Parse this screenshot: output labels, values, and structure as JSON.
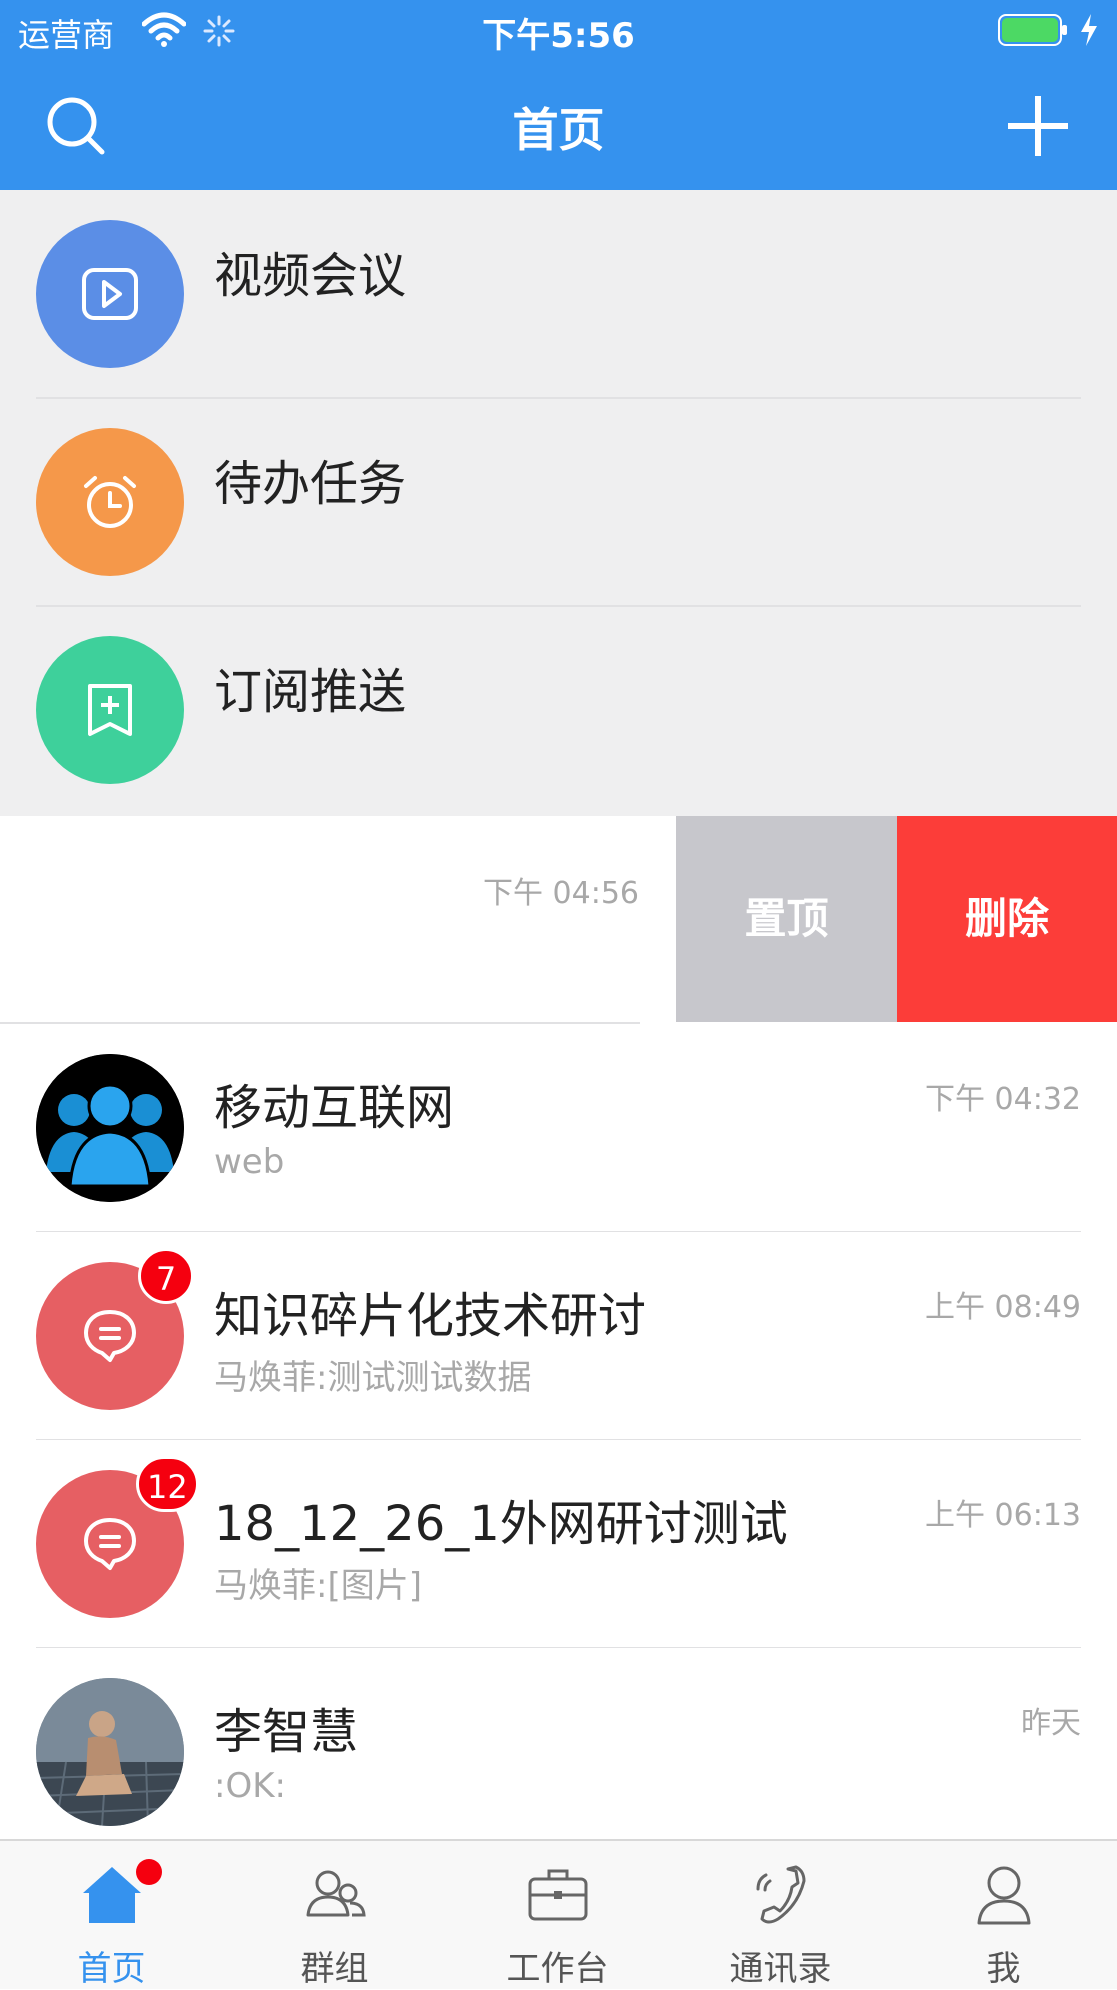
{
  "status_bar": {
    "carrier": "运营商",
    "time": "下午5:56",
    "battery_color": "#4cd964"
  },
  "nav": {
    "title": "首页"
  },
  "shortcuts": [
    {
      "label": "视频会议",
      "color": "#5b8ee6",
      "icon": "play-icon"
    },
    {
      "label": "待办任务",
      "color": "#f5984a",
      "icon": "alarm-clock-icon"
    },
    {
      "label": "订阅推送",
      "color": "#3ed09b",
      "icon": "bookmark-plus-icon"
    }
  ],
  "swiped_row": {
    "time": "下午 04:56",
    "pin_label": "置顶",
    "delete_label": "删除"
  },
  "chats": [
    {
      "name": "移动互联网",
      "preview": "web",
      "time": "下午 04:32",
      "avatar": "group-avatar"
    },
    {
      "name": "知识碎片化技术研讨",
      "preview": "马焕菲:测试测试数据",
      "time": "上午 08:49",
      "badge": "7",
      "avatar": "chat-bubble-icon"
    },
    {
      "name": "18_12_26_1外网研讨测试",
      "preview": "马焕菲:[图片]",
      "time": "上午 06:13",
      "badge": "12",
      "avatar": "chat-bubble-icon"
    },
    {
      "name": "李智慧",
      "preview": ":OK:",
      "time": "昨天",
      "avatar": "photo-avatar"
    }
  ],
  "tabs": [
    {
      "label": "首页",
      "icon": "home-icon",
      "active": true
    },
    {
      "label": "群组",
      "icon": "group-icon"
    },
    {
      "label": "工作台",
      "icon": "briefcase-icon"
    },
    {
      "label": "通讯录",
      "icon": "phone-icon"
    },
    {
      "label": "我",
      "icon": "person-icon"
    }
  ],
  "colors": {
    "primary": "#3592ee",
    "delete": "#fc3d39",
    "pin": "#c7c7cc",
    "badge": "#f5000f"
  }
}
